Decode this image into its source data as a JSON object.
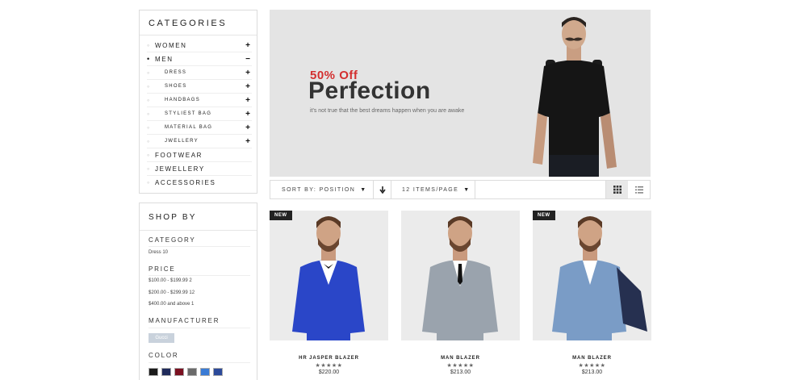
{
  "categories": {
    "title": "CATEGORIES",
    "items": [
      {
        "label": "WOMEN",
        "toggle": "+",
        "bullet": "◦"
      },
      {
        "label": "MEN",
        "toggle": "−",
        "bullet": "•"
      },
      {
        "label": "DRESS",
        "toggle": "+",
        "bullet": "◦"
      },
      {
        "label": "SHOES",
        "toggle": "+",
        "bullet": "◦"
      },
      {
        "label": "HANDBAGS",
        "toggle": "+",
        "bullet": "◦"
      },
      {
        "label": "STYLIEST BAG",
        "toggle": "+",
        "bullet": "◦"
      },
      {
        "label": "MATERIAL BAG",
        "toggle": "+",
        "bullet": "◦"
      },
      {
        "label": "JWELLERY",
        "toggle": "+",
        "bullet": "◦"
      },
      {
        "label": "FOOTWEAR",
        "toggle": "",
        "bullet": "◦"
      },
      {
        "label": "JEWELLERY",
        "toggle": "",
        "bullet": "◦"
      },
      {
        "label": "ACCESSORIES",
        "toggle": "",
        "bullet": "◦"
      }
    ]
  },
  "shop_by": {
    "title": "SHOP BY",
    "category_heading": "CATEGORY",
    "category_item": "Dress 10",
    "price_heading": "PRICE",
    "price_items": [
      "$100.00 - $199.99 2",
      "$200.00 - $299.99 12",
      "$400.00 and above 1"
    ],
    "manufacturer_heading": "MANUFACTURER",
    "manufacturer_item": "Gucci",
    "color_heading": "COLOR",
    "colors": [
      "#1a1a1a",
      "#1f2a5a",
      "#7a1020",
      "#6a6a6a",
      "#3a7bd5",
      "#2c4a9a"
    ]
  },
  "banner": {
    "offer": "50% Off",
    "title": "Perfection",
    "description": "it's not true that the best dreams happen when you are awake"
  },
  "toolbar": {
    "sort_label": "SORT BY: POSITION",
    "sort_caret": "▼",
    "direction_icon": "🡓",
    "limit_label": "12 ITEMS/PAGE",
    "limit_caret": "▼"
  },
  "products": [
    {
      "name": "HR JASPER BLAZER",
      "stars": "★★★★★",
      "price": "$220.00",
      "badge": "NEW",
      "suit_color": "#2a46c8"
    },
    {
      "name": "MAN BLAZER",
      "stars": "★★★★★",
      "price": "$213.00",
      "badge": "",
      "suit_color": "#9aa3ad"
    },
    {
      "name": "MAN BLAZER",
      "stars": "★★★★★",
      "price": "$213.00",
      "badge": "NEW",
      "suit_color": "#7a9cc6"
    }
  ],
  "colors": {
    "accent": "#d32f2f",
    "banner_bg": "#e4e4e4",
    "badge_bg": "#222222"
  }
}
